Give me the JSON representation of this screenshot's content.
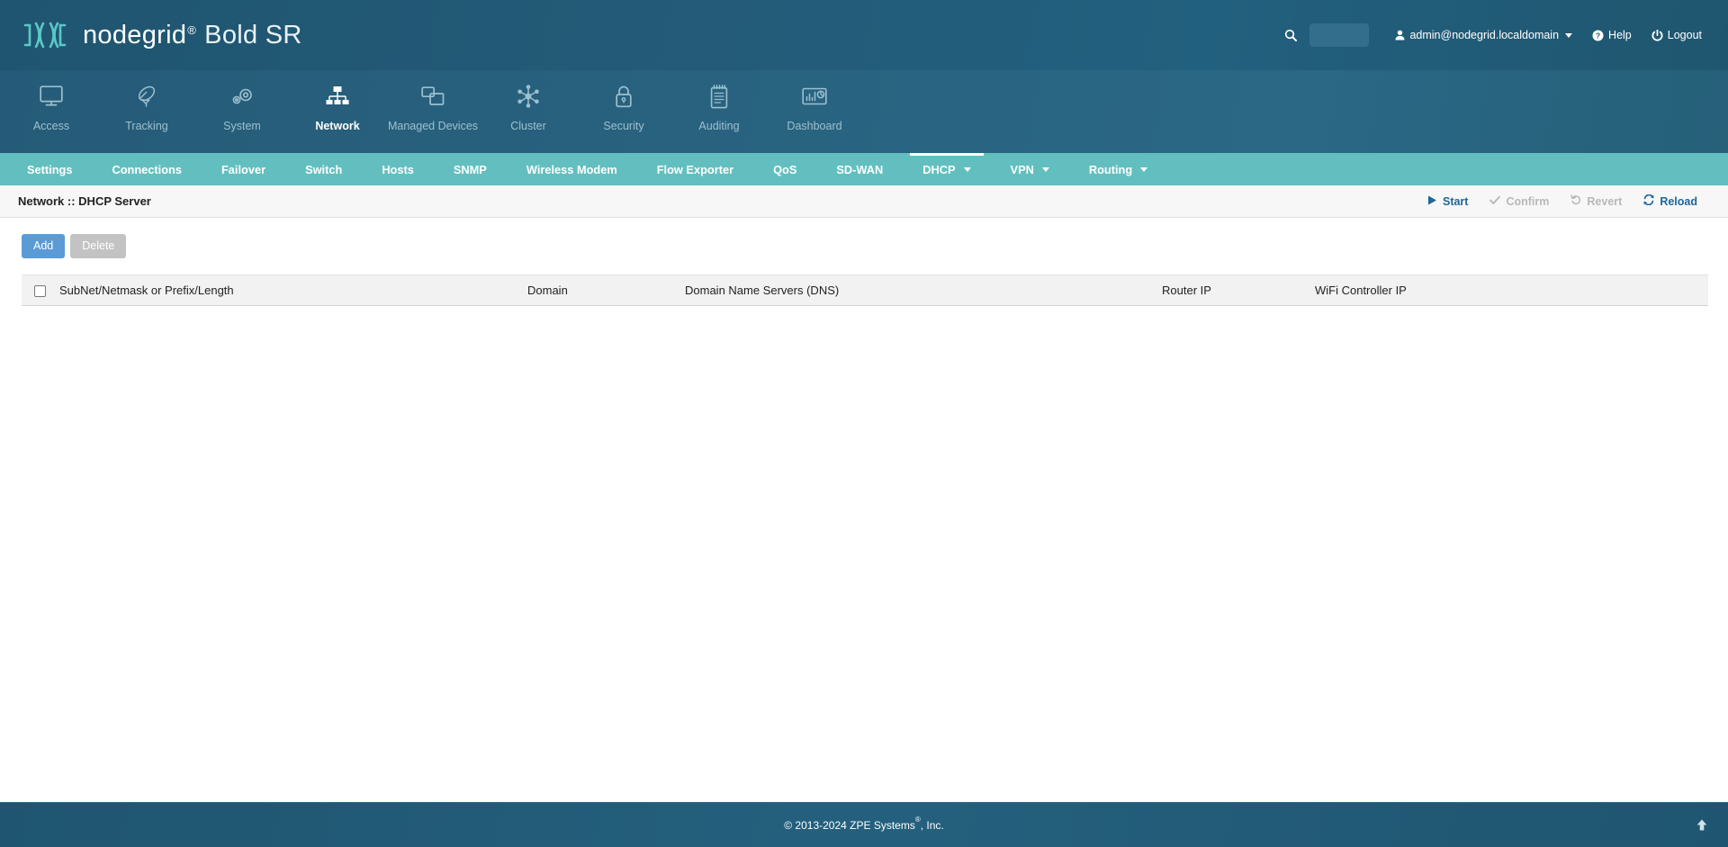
{
  "header": {
    "brand_name": "nodegrid",
    "brand_registered": "®",
    "brand_model": "Bold SR",
    "search_placeholder": "",
    "search_value": "",
    "user": "admin@nodegrid.localdomain",
    "help_label": "Help",
    "logout_label": "Logout"
  },
  "main_nav": {
    "items": [
      {
        "label": "Access",
        "icon": "monitor-icon",
        "active": false
      },
      {
        "label": "Tracking",
        "icon": "satellite-icon",
        "active": false
      },
      {
        "label": "System",
        "icon": "gears-icon",
        "active": false
      },
      {
        "label": "Network",
        "icon": "sitemap-icon",
        "active": true
      },
      {
        "label": "Managed Devices",
        "icon": "windows-icon",
        "active": false
      },
      {
        "label": "Cluster",
        "icon": "hubnodes-icon",
        "active": false
      },
      {
        "label": "Security",
        "icon": "lock-icon",
        "active": false
      },
      {
        "label": "Auditing",
        "icon": "notepad-icon",
        "active": false
      },
      {
        "label": "Dashboard",
        "icon": "chart-icon",
        "active": false
      }
    ]
  },
  "sub_nav": {
    "items": [
      {
        "label": "Settings",
        "active": false,
        "has_caret": false
      },
      {
        "label": "Connections",
        "active": false,
        "has_caret": false
      },
      {
        "label": "Failover",
        "active": false,
        "has_caret": false
      },
      {
        "label": "Switch",
        "active": false,
        "has_caret": false
      },
      {
        "label": "Hosts",
        "active": false,
        "has_caret": false
      },
      {
        "label": "SNMP",
        "active": false,
        "has_caret": false
      },
      {
        "label": "Wireless Modem",
        "active": false,
        "has_caret": false
      },
      {
        "label": "Flow Exporter",
        "active": false,
        "has_caret": false
      },
      {
        "label": "QoS",
        "active": false,
        "has_caret": false
      },
      {
        "label": "SD-WAN",
        "active": false,
        "has_caret": false
      },
      {
        "label": "DHCP",
        "active": true,
        "has_caret": true
      },
      {
        "label": "VPN",
        "active": false,
        "has_caret": true
      },
      {
        "label": "Routing",
        "active": false,
        "has_caret": true
      }
    ]
  },
  "breadcrumb": {
    "title": "Network :: DHCP Server",
    "actions": [
      {
        "label": "Start",
        "icon": "play-icon",
        "enabled": true
      },
      {
        "label": "Confirm",
        "icon": "check-icon",
        "enabled": false
      },
      {
        "label": "Revert",
        "icon": "undo-icon",
        "enabled": false
      },
      {
        "label": "Reload",
        "icon": "refresh-icon",
        "enabled": true
      }
    ]
  },
  "toolbar": {
    "add_label": "Add",
    "delete_label": "Delete",
    "add_enabled": true,
    "delete_enabled": false
  },
  "table": {
    "columns": [
      "SubNet/Netmask or Prefix/Length",
      "Domain",
      "Domain Name Servers (DNS)",
      "Router IP",
      "WiFi Controller IP"
    ],
    "rows": []
  },
  "footer": {
    "copyright_prefix": "© 2013-2024 ZPE Systems",
    "copyright_sup": "®",
    "copyright_suffix": ", Inc."
  },
  "colors": {
    "header_blue": "#235a77",
    "nav_blue": "#28627f",
    "subnav_teal": "#63bfbf",
    "accent_link": "#1f6699",
    "btn_primary": "#5b9bd5",
    "btn_disabled": "#c3c3c3",
    "brand_teal": "#5bc8c8"
  }
}
